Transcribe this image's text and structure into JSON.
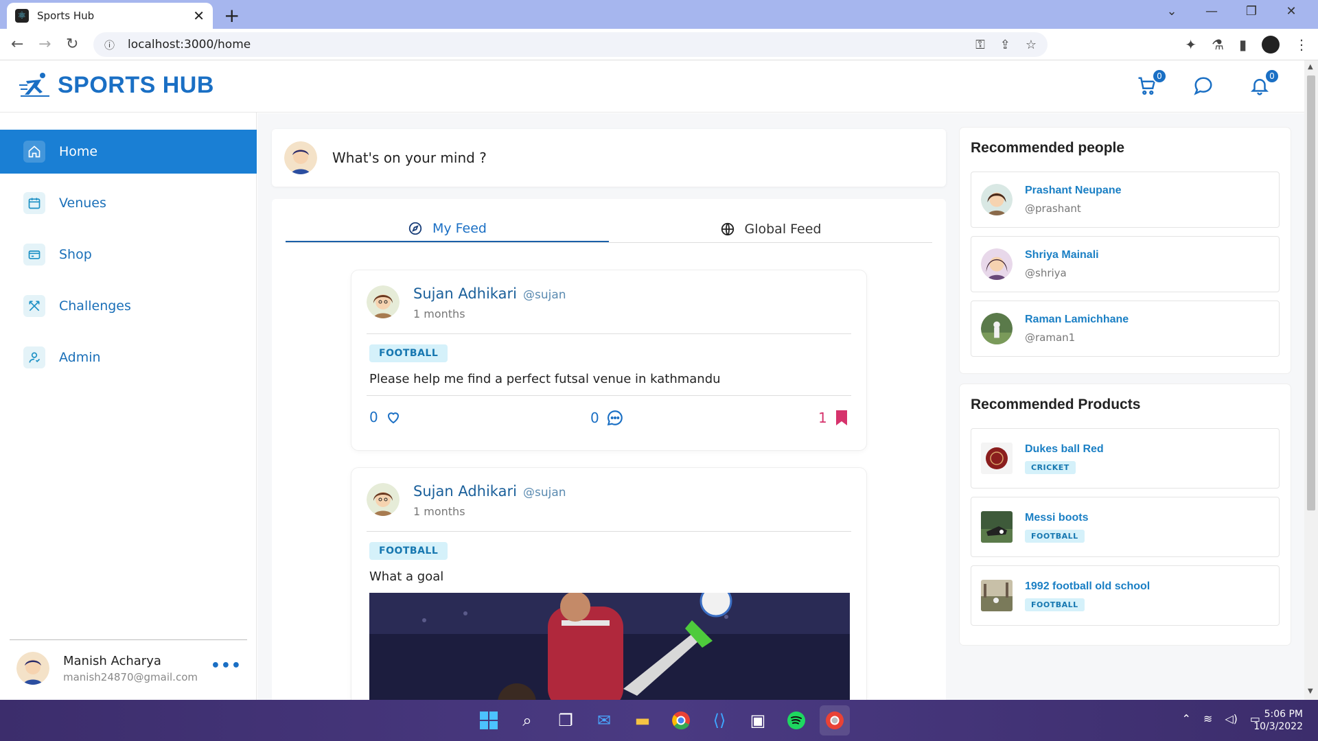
{
  "browser": {
    "tab_title": "Sports Hub",
    "url": "localhost:3000/home"
  },
  "app": {
    "logo_text": "SPORTS HUB",
    "cart_count": "0",
    "notification_count": "0",
    "brand_color": "#1a6fc4"
  },
  "sidebar": {
    "items": [
      {
        "label": "Home",
        "icon": "home-icon"
      },
      {
        "label": "Venues",
        "icon": "calendar-icon"
      },
      {
        "label": "Shop",
        "icon": "card-icon"
      },
      {
        "label": "Challenges",
        "icon": "swords-icon"
      },
      {
        "label": "Admin",
        "icon": "admin-icon"
      }
    ],
    "user": {
      "name": "Manish Acharya",
      "email": "manish24870@gmail.com"
    }
  },
  "compose": {
    "placeholder": "What's on your mind ?"
  },
  "feed": {
    "tabs": [
      {
        "label": "My Feed",
        "icon": "compass-icon"
      },
      {
        "label": "Global Feed",
        "icon": "globe-icon"
      }
    ],
    "posts": [
      {
        "author": "Sujan Adhikari",
        "handle": "@sujan",
        "time": "1 months",
        "tag": "FOOTBALL",
        "text": "Please help me find a perfect futsal venue in kathmandu",
        "likes": "0",
        "comments": "0",
        "bookmarks": "1"
      },
      {
        "author": "Sujan Adhikari",
        "handle": "@sujan",
        "time": "1 months",
        "tag": "FOOTBALL",
        "text": "What a goal"
      }
    ]
  },
  "recommended_people": {
    "title": "Recommended people",
    "items": [
      {
        "name": "Prashant Neupane",
        "handle": "@prashant"
      },
      {
        "name": "Shriya Mainali",
        "handle": "@shriya"
      },
      {
        "name": "Raman Lamichhane",
        "handle": "@raman1"
      }
    ]
  },
  "recommended_products": {
    "title": "Recommended Products",
    "items": [
      {
        "name": "Dukes ball Red",
        "tag": "CRICKET"
      },
      {
        "name": "Messi boots",
        "tag": "FOOTBALL"
      },
      {
        "name": "1992 football old school",
        "tag": "FOOTBALL"
      }
    ]
  },
  "taskbar": {
    "time": "5:06 PM",
    "date": "10/3/2022"
  }
}
